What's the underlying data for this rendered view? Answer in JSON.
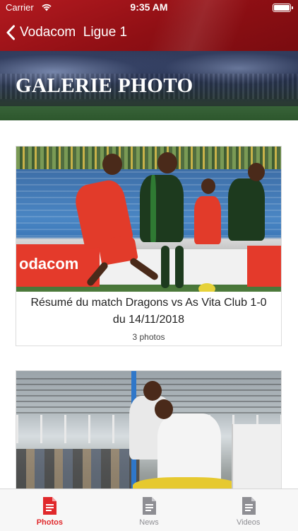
{
  "status_bar": {
    "carrier": "Carrier",
    "time": "9:35 AM"
  },
  "nav": {
    "back_label": "Vodacom  Ligue 1"
  },
  "banner": {
    "title": "GALERIE PHOTO"
  },
  "gallery": {
    "items": [
      {
        "title": "Résumé du match Dragons vs As Vita Club 1-0 du 14/11/2018",
        "count": "3 photos",
        "ad_text": "odacom"
      },
      {
        "title": "",
        "count": ""
      }
    ]
  },
  "tab_bar": {
    "tabs": [
      {
        "label": "Photos",
        "icon": "document-icon",
        "active": true
      },
      {
        "label": "News",
        "icon": "document-icon",
        "active": false
      },
      {
        "label": "Videos",
        "icon": "document-icon",
        "active": false
      }
    ]
  },
  "colors": {
    "header_red": "#b31a20",
    "active_tab": "#e0282b",
    "inactive_tab": "#8e8e93"
  }
}
